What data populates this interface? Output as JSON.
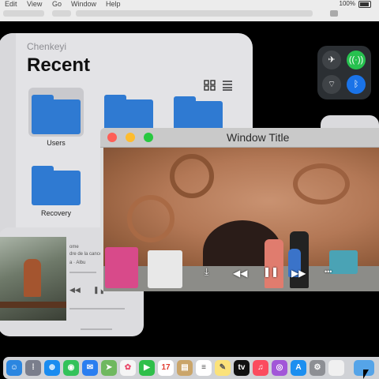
{
  "menubar": {
    "items": [
      "Edit",
      "View",
      "Go",
      "Window",
      "Help"
    ],
    "battery": "100%"
  },
  "finder": {
    "subtitle": "Chenkeyi",
    "title": "Recent",
    "folders": [
      {
        "label": "Users"
      },
      {
        "label": ""
      },
      {
        "label": ""
      },
      {
        "label": "Recovery"
      }
    ]
  },
  "control_center": {
    "buttons": [
      "airplane-icon",
      "wifi-signal-icon",
      "wifi-off-icon",
      "bluetooth-icon"
    ],
    "colors": {
      "airplane": "#3f4347",
      "wifi_signal": "#27c14f",
      "wifi_off": "#3f4347",
      "bluetooth": "#1a73e8"
    }
  },
  "player": {
    "line1": "ome",
    "line2": "dre de la cance",
    "line3": "a  ·  Albu",
    "controls": {
      "rewind": "◀◀",
      "pause": "❚❚"
    }
  },
  "window": {
    "title": "Window Title",
    "controls": {
      "rewind": "◀◀",
      "pause": "❚❚",
      "forward": "▶▶",
      "more": "•••",
      "download": "⤓"
    }
  },
  "dock": {
    "calendar_day": "17",
    "tv_label": "tv",
    "apps": [
      "finder-icon",
      "launchpad-icon",
      "safari-icon",
      "messages-icon",
      "mail-icon",
      "maps-icon",
      "photos-icon",
      "facetime-icon",
      "calendar-icon",
      "notes-folder-icon",
      "reminders-icon",
      "notes-icon",
      "tv-icon",
      "music-icon",
      "podcasts-icon",
      "app-store-icon",
      "settings-icon",
      "blank-icon",
      "folder-icon"
    ]
  }
}
